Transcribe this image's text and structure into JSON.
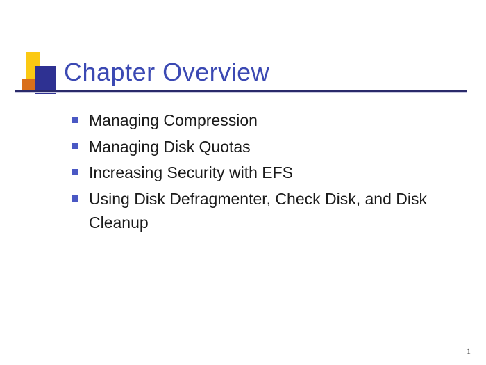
{
  "title": "Chapter Overview",
  "bullets": [
    "Managing Compression",
    "Managing Disk Quotas",
    "Increasing Security with EFS",
    "Using Disk Defragmenter, Check Disk, and Disk Cleanup"
  ],
  "page_number": "1"
}
